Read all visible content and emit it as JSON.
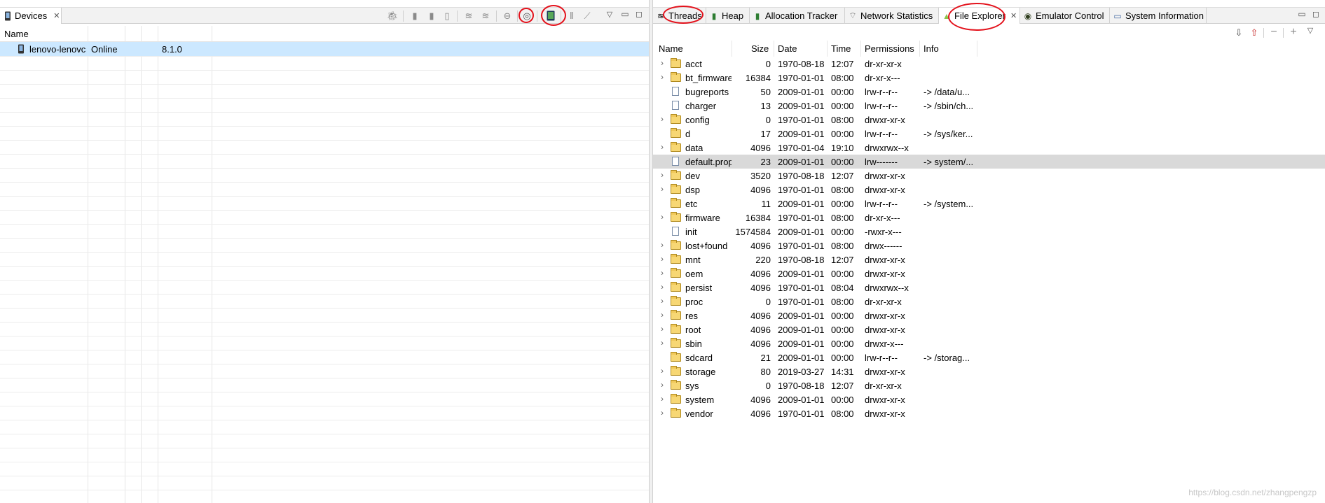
{
  "devices_view": {
    "tab_label": "Devices",
    "column_name": "Name",
    "device": {
      "name": "lenovo-lenovc",
      "state": "Online",
      "version": "8.1.0"
    }
  },
  "right_tabs": [
    {
      "label": "Threads",
      "icon": "threads-icon"
    },
    {
      "label": "Heap",
      "icon": "heap-icon"
    },
    {
      "label": "Allocation Tracker",
      "icon": "allocation-icon"
    },
    {
      "label": "Network Statistics",
      "icon": "network-icon"
    },
    {
      "label": "File Explorer",
      "icon": "android-icon"
    },
    {
      "label": "Emulator Control",
      "icon": "emulator-icon"
    },
    {
      "label": "System Information",
      "icon": "sysinfo-icon"
    }
  ],
  "file_explorer": {
    "columns": [
      "Name",
      "Size",
      "Date",
      "Time",
      "Permissions",
      "Info"
    ],
    "rows": [
      {
        "name": "acct",
        "size": "0",
        "date": "1970-08-18",
        "time": "12:07",
        "perm": "dr-xr-xr-x",
        "info": "",
        "type": "folder",
        "expand": true
      },
      {
        "name": "bt_firmware",
        "size": "16384",
        "date": "1970-01-01",
        "time": "08:00",
        "perm": "dr-xr-x---",
        "info": "",
        "type": "folder",
        "expand": true
      },
      {
        "name": "bugreports",
        "size": "50",
        "date": "2009-01-01",
        "time": "00:00",
        "perm": "lrw-r--r--",
        "info": "-> /data/u...",
        "type": "file",
        "expand": false
      },
      {
        "name": "charger",
        "size": "13",
        "date": "2009-01-01",
        "time": "00:00",
        "perm": "lrw-r--r--",
        "info": "-> /sbin/ch...",
        "type": "file",
        "expand": false
      },
      {
        "name": "config",
        "size": "0",
        "date": "1970-01-01",
        "time": "08:00",
        "perm": "drwxr-xr-x",
        "info": "",
        "type": "folder",
        "expand": true
      },
      {
        "name": "d",
        "size": "17",
        "date": "2009-01-01",
        "time": "00:00",
        "perm": "lrw-r--r--",
        "info": "-> /sys/ker...",
        "type": "folder",
        "expand": false
      },
      {
        "name": "data",
        "size": "4096",
        "date": "1970-01-04",
        "time": "19:10",
        "perm": "drwxrwx--x",
        "info": "",
        "type": "folder",
        "expand": true
      },
      {
        "name": "default.prop",
        "size": "23",
        "date": "2009-01-01",
        "time": "00:00",
        "perm": "lrw-------",
        "info": "-> system/...",
        "type": "file",
        "expand": false,
        "selected": true
      },
      {
        "name": "dev",
        "size": "3520",
        "date": "1970-08-18",
        "time": "12:07",
        "perm": "drwxr-xr-x",
        "info": "",
        "type": "folder",
        "expand": true
      },
      {
        "name": "dsp",
        "size": "4096",
        "date": "1970-01-01",
        "time": "08:00",
        "perm": "drwxr-xr-x",
        "info": "",
        "type": "folder",
        "expand": true
      },
      {
        "name": "etc",
        "size": "11",
        "date": "2009-01-01",
        "time": "00:00",
        "perm": "lrw-r--r--",
        "info": "-> /system...",
        "type": "folder",
        "expand": false
      },
      {
        "name": "firmware",
        "size": "16384",
        "date": "1970-01-01",
        "time": "08:00",
        "perm": "dr-xr-x---",
        "info": "",
        "type": "folder",
        "expand": true
      },
      {
        "name": "init",
        "size": "1574584",
        "date": "2009-01-01",
        "time": "00:00",
        "perm": "-rwxr-x---",
        "info": "",
        "type": "file",
        "expand": false
      },
      {
        "name": "lost+found",
        "size": "4096",
        "date": "1970-01-01",
        "time": "08:00",
        "perm": "drwx------",
        "info": "",
        "type": "folder",
        "expand": true
      },
      {
        "name": "mnt",
        "size": "220",
        "date": "1970-08-18",
        "time": "12:07",
        "perm": "drwxr-xr-x",
        "info": "",
        "type": "folder",
        "expand": true
      },
      {
        "name": "oem",
        "size": "4096",
        "date": "2009-01-01",
        "time": "00:00",
        "perm": "drwxr-xr-x",
        "info": "",
        "type": "folder",
        "expand": true
      },
      {
        "name": "persist",
        "size": "4096",
        "date": "1970-01-01",
        "time": "08:04",
        "perm": "drwxrwx--x",
        "info": "",
        "type": "folder",
        "expand": true
      },
      {
        "name": "proc",
        "size": "0",
        "date": "1970-01-01",
        "time": "08:00",
        "perm": "dr-xr-xr-x",
        "info": "",
        "type": "folder",
        "expand": true
      },
      {
        "name": "res",
        "size": "4096",
        "date": "2009-01-01",
        "time": "00:00",
        "perm": "drwxr-xr-x",
        "info": "",
        "type": "folder",
        "expand": true
      },
      {
        "name": "root",
        "size": "4096",
        "date": "2009-01-01",
        "time": "00:00",
        "perm": "drwxr-xr-x",
        "info": "",
        "type": "folder",
        "expand": true
      },
      {
        "name": "sbin",
        "size": "4096",
        "date": "2009-01-01",
        "time": "00:00",
        "perm": "drwxr-x---",
        "info": "",
        "type": "folder",
        "expand": true
      },
      {
        "name": "sdcard",
        "size": "21",
        "date": "2009-01-01",
        "time": "00:00",
        "perm": "lrw-r--r--",
        "info": "-> /storag...",
        "type": "folder",
        "expand": false
      },
      {
        "name": "storage",
        "size": "80",
        "date": "2019-03-27",
        "time": "14:31",
        "perm": "drwxr-xr-x",
        "info": "",
        "type": "folder",
        "expand": true
      },
      {
        "name": "sys",
        "size": "0",
        "date": "1970-08-18",
        "time": "12:07",
        "perm": "dr-xr-xr-x",
        "info": "",
        "type": "folder",
        "expand": true
      },
      {
        "name": "system",
        "size": "4096",
        "date": "2009-01-01",
        "time": "00:00",
        "perm": "drwxr-xr-x",
        "info": "",
        "type": "folder",
        "expand": true
      },
      {
        "name": "vendor",
        "size": "4096",
        "date": "1970-01-01",
        "time": "08:00",
        "perm": "drwxr-xr-x",
        "info": "",
        "type": "folder",
        "expand": true
      }
    ]
  },
  "watermark": "https://blog.csdn.net/zhangpengzp",
  "colors": {
    "selection": "#cce8ff",
    "highlight_circle": "#e3101a",
    "folder": "#f7d774"
  }
}
